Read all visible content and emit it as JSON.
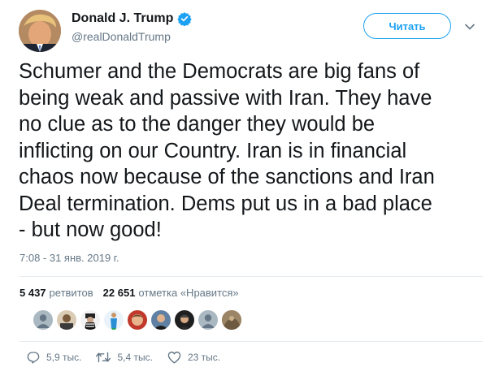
{
  "author": {
    "display_name": "Donald J. Trump",
    "screen_name": "@realDonaldTrump",
    "verified_icon": "verified-badge-icon"
  },
  "header": {
    "follow_label": "Читать",
    "more_icon": "chevron-down-icon"
  },
  "tweet": {
    "text": "Schumer and the Democrats are big fans of\nbeing weak and passive with Iran. They have\nno clue as to the danger they would be\ninflicting on our Country. Iran is in financial\nchaos now because of the sanctions and Iran\nDeal termination. Dems put us in a bad place\n- but now good!",
    "timestamp": "7:08 - 31 янв. 2019 г."
  },
  "stats": {
    "retweets_count": "5 437",
    "retweets_label": "ретвитов",
    "likes_count": "22 651",
    "likes_label": "отметка «Нравится»"
  },
  "likers": [
    {
      "icon": "default-avatar-icon"
    },
    {
      "icon": "user-avatar-icon"
    },
    {
      "icon": "user-avatar-icon"
    },
    {
      "icon": "user-avatar-icon"
    },
    {
      "icon": "user-avatar-icon"
    },
    {
      "icon": "user-avatar-icon"
    },
    {
      "icon": "user-avatar-icon"
    },
    {
      "icon": "default-avatar-icon"
    },
    {
      "icon": "user-avatar-icon"
    }
  ],
  "actions": {
    "replies": "5,9 тыс.",
    "retweets": "5,4 тыс.",
    "likes": "23 тыс."
  },
  "colors": {
    "accent": "#1da1f2",
    "text": "#14171a",
    "secondary": "#657786",
    "divider": "#e6ecf0"
  }
}
